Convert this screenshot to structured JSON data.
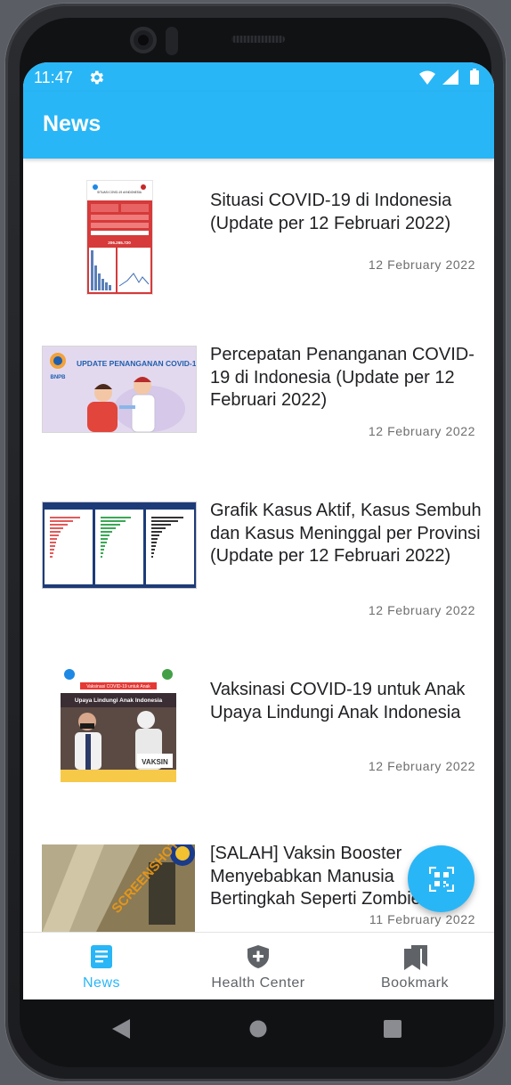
{
  "status_bar": {
    "time": "11:47",
    "settings_icon": "gear-icon",
    "wifi_icon": "wifi-icon",
    "signal_icon": "signal-icon",
    "battery_icon": "battery-icon"
  },
  "app_bar": {
    "title": "News"
  },
  "news": [
    {
      "title": "Situasi COVID-19 di Indonesia (Update per 12 Februari 2022)",
      "date": "12 February 2022"
    },
    {
      "title": "Percepatan Penanganan COVID-19 di Indonesia (Update per 12 Februari 2022)",
      "date": "12 February 2022"
    },
    {
      "title": "Grafik Kasus Aktif, Kasus Sembuh dan Kasus Meninggal per Provinsi (Update per 12 Februari 2022)",
      "date": "12 February 2022"
    },
    {
      "title": "Vaksinasi COVID-19 untuk Anak Upaya Lindungi Anak Indonesia",
      "date": "12 February 2022"
    },
    {
      "title": "[SALAH] Vaksin Booster Menyebabkan Manusia Bertingkah Seperti Zombie",
      "date": "11 February 2022"
    }
  ],
  "thumb_text": {
    "t1_heading": "SITUASI COVID-19 di INDONESIA",
    "t1_total": "206.265.720",
    "t2_heading": "UPDATE PENANGANAN COVID-19",
    "t2_org": "BNPB",
    "t4_heading": "Vaksinasi COVID-19 untuk Anak",
    "t4_sub": "Upaya Lindungi Anak Indonesia",
    "t4_sign": "VAKSIN",
    "t5_stamp": "SCREENSHOT BY"
  },
  "fab": {
    "icon": "qr-scan-icon"
  },
  "bottom_nav": [
    {
      "label": "News",
      "icon": "newspaper-icon",
      "active": true
    },
    {
      "label": "Health Center",
      "icon": "shield-plus-icon",
      "active": false
    },
    {
      "label": "Bookmark",
      "icon": "bookmarks-icon",
      "active": false
    }
  ],
  "system_nav": {
    "back_icon": "back-icon",
    "home_icon": "home-icon",
    "recents_icon": "recents-icon"
  },
  "colors": {
    "primary": "#29b6f6",
    "text": "#202124",
    "muted": "#6e6e6e",
    "inactive": "#5f6368"
  }
}
